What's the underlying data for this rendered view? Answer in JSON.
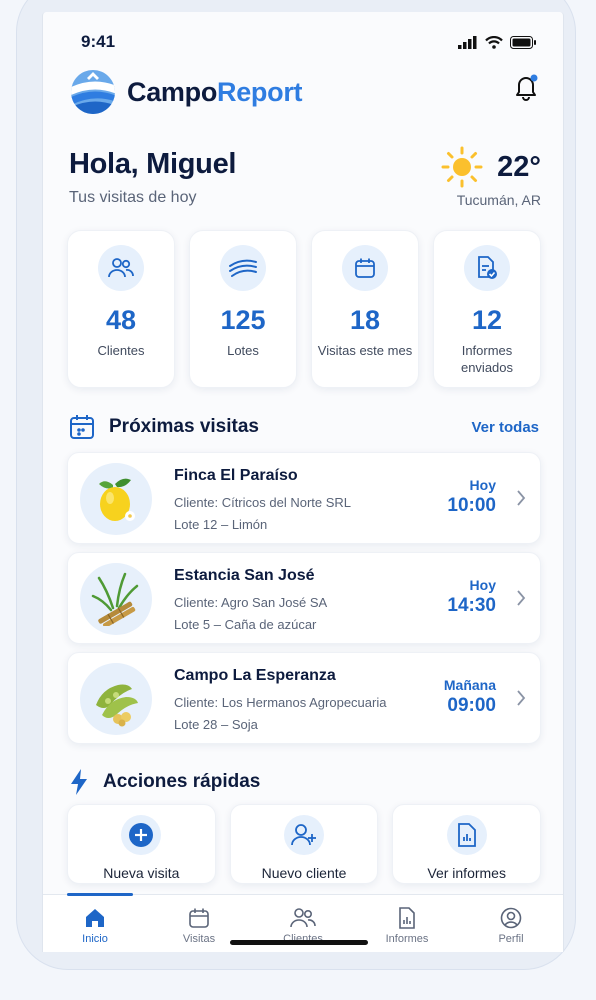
{
  "status": {
    "time": "9:41"
  },
  "brand": {
    "name_part1": "Campo",
    "name_part2": "Report"
  },
  "greeting": {
    "title": "Hola, Miguel",
    "subtitle": "Tus visitas de hoy"
  },
  "weather": {
    "temp": "22°",
    "location": "Tucumán, AR",
    "icon": "sun-icon"
  },
  "stats": [
    {
      "icon": "users-icon",
      "value": "48",
      "label": "Clientes"
    },
    {
      "icon": "field-icon",
      "value": "125",
      "label": "Lotes"
    },
    {
      "icon": "calendar-icon",
      "value": "18",
      "label": "Visitas este mes"
    },
    {
      "icon": "report-check-icon",
      "value": "12",
      "label": "Informes enviados"
    }
  ],
  "upcoming": {
    "title": "Próximas visitas",
    "see_all": "Ver todas",
    "items": [
      {
        "title": "Finca El Paraíso",
        "client": "Cliente: Cítricos del Norte SRL",
        "lote": "Lote 12 – Limón",
        "day": "Hoy",
        "hour": "10:00",
        "icon": "lemon-icon"
      },
      {
        "title": "Estancia San José",
        "client": "Cliente: Agro San José SA",
        "lote": "Lote 5 – Caña de azúcar",
        "day": "Hoy",
        "hour": "14:30",
        "icon": "sugarcane-icon"
      },
      {
        "title": "Campo La Esperanza",
        "client": "Cliente: Los Hermanos Agropecuaria",
        "lote": "Lote 28 – Soja",
        "day": "Mañana",
        "hour": "09:00",
        "icon": "soy-icon"
      }
    ]
  },
  "quick_actions": {
    "title": "Acciones rápidas",
    "items": [
      {
        "label": "Nueva visita",
        "icon": "plus-icon"
      },
      {
        "label": "Nuevo cliente",
        "icon": "add-user-icon"
      },
      {
        "label": "Ver informes",
        "icon": "report-icon"
      }
    ]
  },
  "tabs": [
    {
      "label": "Inicio",
      "icon": "home-icon",
      "active": true
    },
    {
      "label": "Visitas",
      "icon": "calendar-icon"
    },
    {
      "label": "Clientes",
      "icon": "users-icon"
    },
    {
      "label": "Informes",
      "icon": "report-icon"
    },
    {
      "label": "Perfil",
      "icon": "profile-icon"
    }
  ],
  "colors": {
    "primary": "#1e66c7",
    "accent": "#2f7de1",
    "text": "#0d1b3e"
  }
}
